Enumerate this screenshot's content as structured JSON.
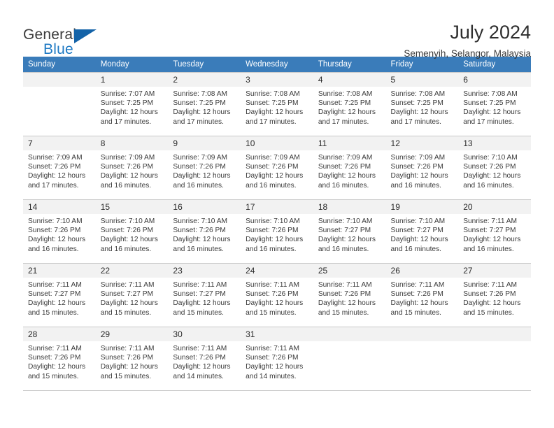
{
  "brand": {
    "name_part1": "General",
    "name_part2": "Blue",
    "mark": "triangle-logo"
  },
  "header": {
    "title": "July 2024",
    "subtitle": "Semenyih, Selangor, Malaysia"
  },
  "calendar": {
    "weekday_headers": [
      "Sunday",
      "Monday",
      "Tuesday",
      "Wednesday",
      "Thursday",
      "Friday",
      "Saturday"
    ],
    "accent_color": "#3a7cba",
    "daynum_bg": "#f2f2f2",
    "weeks": [
      [
        {
          "day": "",
          "sunrise": "",
          "sunset": "",
          "daylight1": "",
          "daylight2": ""
        },
        {
          "day": "1",
          "sunrise": "Sunrise: 7:07 AM",
          "sunset": "Sunset: 7:25 PM",
          "daylight1": "Daylight: 12 hours",
          "daylight2": "and 17 minutes."
        },
        {
          "day": "2",
          "sunrise": "Sunrise: 7:08 AM",
          "sunset": "Sunset: 7:25 PM",
          "daylight1": "Daylight: 12 hours",
          "daylight2": "and 17 minutes."
        },
        {
          "day": "3",
          "sunrise": "Sunrise: 7:08 AM",
          "sunset": "Sunset: 7:25 PM",
          "daylight1": "Daylight: 12 hours",
          "daylight2": "and 17 minutes."
        },
        {
          "day": "4",
          "sunrise": "Sunrise: 7:08 AM",
          "sunset": "Sunset: 7:25 PM",
          "daylight1": "Daylight: 12 hours",
          "daylight2": "and 17 minutes."
        },
        {
          "day": "5",
          "sunrise": "Sunrise: 7:08 AM",
          "sunset": "Sunset: 7:25 PM",
          "daylight1": "Daylight: 12 hours",
          "daylight2": "and 17 minutes."
        },
        {
          "day": "6",
          "sunrise": "Sunrise: 7:08 AM",
          "sunset": "Sunset: 7:25 PM",
          "daylight1": "Daylight: 12 hours",
          "daylight2": "and 17 minutes."
        }
      ],
      [
        {
          "day": "7",
          "sunrise": "Sunrise: 7:09 AM",
          "sunset": "Sunset: 7:26 PM",
          "daylight1": "Daylight: 12 hours",
          "daylight2": "and 17 minutes."
        },
        {
          "day": "8",
          "sunrise": "Sunrise: 7:09 AM",
          "sunset": "Sunset: 7:26 PM",
          "daylight1": "Daylight: 12 hours",
          "daylight2": "and 16 minutes."
        },
        {
          "day": "9",
          "sunrise": "Sunrise: 7:09 AM",
          "sunset": "Sunset: 7:26 PM",
          "daylight1": "Daylight: 12 hours",
          "daylight2": "and 16 minutes."
        },
        {
          "day": "10",
          "sunrise": "Sunrise: 7:09 AM",
          "sunset": "Sunset: 7:26 PM",
          "daylight1": "Daylight: 12 hours",
          "daylight2": "and 16 minutes."
        },
        {
          "day": "11",
          "sunrise": "Sunrise: 7:09 AM",
          "sunset": "Sunset: 7:26 PM",
          "daylight1": "Daylight: 12 hours",
          "daylight2": "and 16 minutes."
        },
        {
          "day": "12",
          "sunrise": "Sunrise: 7:09 AM",
          "sunset": "Sunset: 7:26 PM",
          "daylight1": "Daylight: 12 hours",
          "daylight2": "and 16 minutes."
        },
        {
          "day": "13",
          "sunrise": "Sunrise: 7:10 AM",
          "sunset": "Sunset: 7:26 PM",
          "daylight1": "Daylight: 12 hours",
          "daylight2": "and 16 minutes."
        }
      ],
      [
        {
          "day": "14",
          "sunrise": "Sunrise: 7:10 AM",
          "sunset": "Sunset: 7:26 PM",
          "daylight1": "Daylight: 12 hours",
          "daylight2": "and 16 minutes."
        },
        {
          "day": "15",
          "sunrise": "Sunrise: 7:10 AM",
          "sunset": "Sunset: 7:26 PM",
          "daylight1": "Daylight: 12 hours",
          "daylight2": "and 16 minutes."
        },
        {
          "day": "16",
          "sunrise": "Sunrise: 7:10 AM",
          "sunset": "Sunset: 7:26 PM",
          "daylight1": "Daylight: 12 hours",
          "daylight2": "and 16 minutes."
        },
        {
          "day": "17",
          "sunrise": "Sunrise: 7:10 AM",
          "sunset": "Sunset: 7:26 PM",
          "daylight1": "Daylight: 12 hours",
          "daylight2": "and 16 minutes."
        },
        {
          "day": "18",
          "sunrise": "Sunrise: 7:10 AM",
          "sunset": "Sunset: 7:27 PM",
          "daylight1": "Daylight: 12 hours",
          "daylight2": "and 16 minutes."
        },
        {
          "day": "19",
          "sunrise": "Sunrise: 7:10 AM",
          "sunset": "Sunset: 7:27 PM",
          "daylight1": "Daylight: 12 hours",
          "daylight2": "and 16 minutes."
        },
        {
          "day": "20",
          "sunrise": "Sunrise: 7:11 AM",
          "sunset": "Sunset: 7:27 PM",
          "daylight1": "Daylight: 12 hours",
          "daylight2": "and 16 minutes."
        }
      ],
      [
        {
          "day": "21",
          "sunrise": "Sunrise: 7:11 AM",
          "sunset": "Sunset: 7:27 PM",
          "daylight1": "Daylight: 12 hours",
          "daylight2": "and 15 minutes."
        },
        {
          "day": "22",
          "sunrise": "Sunrise: 7:11 AM",
          "sunset": "Sunset: 7:27 PM",
          "daylight1": "Daylight: 12 hours",
          "daylight2": "and 15 minutes."
        },
        {
          "day": "23",
          "sunrise": "Sunrise: 7:11 AM",
          "sunset": "Sunset: 7:27 PM",
          "daylight1": "Daylight: 12 hours",
          "daylight2": "and 15 minutes."
        },
        {
          "day": "24",
          "sunrise": "Sunrise: 7:11 AM",
          "sunset": "Sunset: 7:26 PM",
          "daylight1": "Daylight: 12 hours",
          "daylight2": "and 15 minutes."
        },
        {
          "day": "25",
          "sunrise": "Sunrise: 7:11 AM",
          "sunset": "Sunset: 7:26 PM",
          "daylight1": "Daylight: 12 hours",
          "daylight2": "and 15 minutes."
        },
        {
          "day": "26",
          "sunrise": "Sunrise: 7:11 AM",
          "sunset": "Sunset: 7:26 PM",
          "daylight1": "Daylight: 12 hours",
          "daylight2": "and 15 minutes."
        },
        {
          "day": "27",
          "sunrise": "Sunrise: 7:11 AM",
          "sunset": "Sunset: 7:26 PM",
          "daylight1": "Daylight: 12 hours",
          "daylight2": "and 15 minutes."
        }
      ],
      [
        {
          "day": "28",
          "sunrise": "Sunrise: 7:11 AM",
          "sunset": "Sunset: 7:26 PM",
          "daylight1": "Daylight: 12 hours",
          "daylight2": "and 15 minutes."
        },
        {
          "day": "29",
          "sunrise": "Sunrise: 7:11 AM",
          "sunset": "Sunset: 7:26 PM",
          "daylight1": "Daylight: 12 hours",
          "daylight2": "and 15 minutes."
        },
        {
          "day": "30",
          "sunrise": "Sunrise: 7:11 AM",
          "sunset": "Sunset: 7:26 PM",
          "daylight1": "Daylight: 12 hours",
          "daylight2": "and 14 minutes."
        },
        {
          "day": "31",
          "sunrise": "Sunrise: 7:11 AM",
          "sunset": "Sunset: 7:26 PM",
          "daylight1": "Daylight: 12 hours",
          "daylight2": "and 14 minutes."
        },
        {
          "day": "",
          "sunrise": "",
          "sunset": "",
          "daylight1": "",
          "daylight2": ""
        },
        {
          "day": "",
          "sunrise": "",
          "sunset": "",
          "daylight1": "",
          "daylight2": ""
        },
        {
          "day": "",
          "sunrise": "",
          "sunset": "",
          "daylight1": "",
          "daylight2": ""
        }
      ]
    ]
  }
}
